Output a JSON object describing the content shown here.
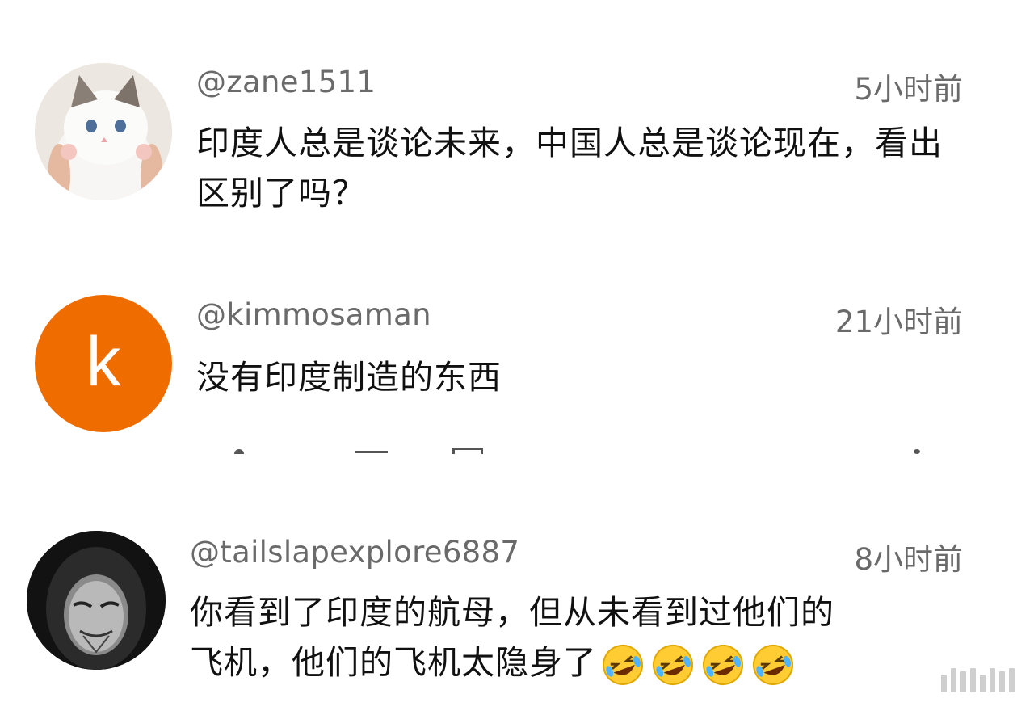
{
  "comments": [
    {
      "username": "@zane1511",
      "time": "5小时前",
      "text": "印度人总是谈论未来，中国人总是谈论现在，看出区别了吗？",
      "avatar": "cat-photo"
    },
    {
      "username": "@kimmosaman",
      "time": "21小时前",
      "text": "没有印度制造的东西",
      "avatar_letter": "k",
      "avatar_color": "#ef6c00"
    },
    {
      "username": "@tailslapexplore6887",
      "time": "8小时前",
      "text_line1": "你看到了印度的航母，但从未看到过他们的",
      "text_line2": "飞机，他们的飞机太隐身了",
      "emoji": "rolling-on-floor-laughing",
      "avatar": "hooded-mask-photo"
    }
  ]
}
